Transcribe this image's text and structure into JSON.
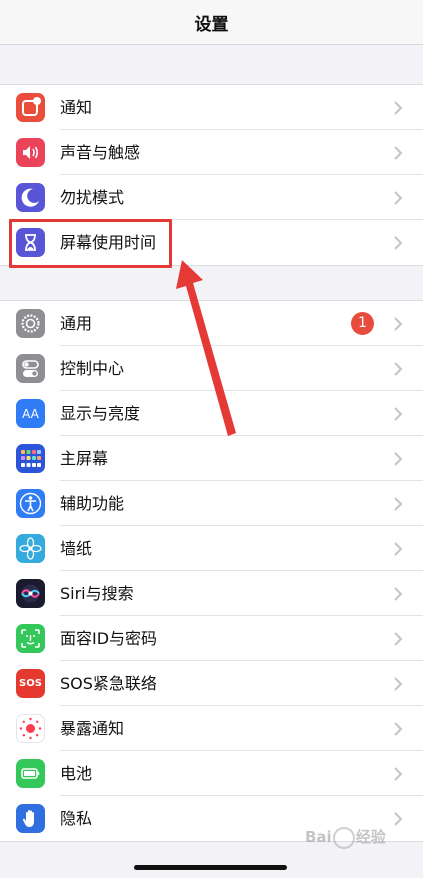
{
  "nav": {
    "title": "设置"
  },
  "group1": [
    {
      "label": "通知",
      "icon": "notifications-icon",
      "color": "#eb4d3d"
    },
    {
      "label": "声音与触感",
      "icon": "sound-icon",
      "color": "#eb445a"
    },
    {
      "label": "勿扰模式",
      "icon": "moon-icon",
      "color": "#5856d6"
    },
    {
      "label": "屏幕使用时间",
      "icon": "hourglass-icon",
      "color": "#5856d6"
    }
  ],
  "group2": [
    {
      "label": "通用",
      "icon": "gear-icon",
      "color": "#8e8e93",
      "badge": "1"
    },
    {
      "label": "控制中心",
      "icon": "toggles-icon",
      "color": "#8e8e93"
    },
    {
      "label": "显示与亮度",
      "icon": "aa-icon",
      "color": "#2f7cf6",
      "icon_text": "AA"
    },
    {
      "label": "主屏幕",
      "icon": "grid-icon",
      "color": "#2d55d9"
    },
    {
      "label": "辅助功能",
      "icon": "accessibility-icon",
      "color": "#2f7cf6"
    },
    {
      "label": "墙纸",
      "icon": "flower-icon",
      "color": "#35aadc"
    },
    {
      "label": "Siri与搜索",
      "icon": "siri-icon",
      "color": "#1b1b2f"
    },
    {
      "label": "面容ID与密码",
      "icon": "faceid-icon",
      "color": "#34c759"
    },
    {
      "label": "SOS紧急联络",
      "icon": "sos-icon",
      "color": "#e5382f",
      "icon_text": "SOS"
    },
    {
      "label": "暴露通知",
      "icon": "exposure-icon",
      "color": "#ffffff"
    },
    {
      "label": "电池",
      "icon": "battery-icon",
      "color": "#34c759"
    },
    {
      "label": "隐私",
      "icon": "hand-icon",
      "color": "#2f6fe0"
    }
  ],
  "annotation": {
    "color": "#e53935"
  },
  "watermark": {
    "text_left": "Bai",
    "text_right": "经验"
  }
}
